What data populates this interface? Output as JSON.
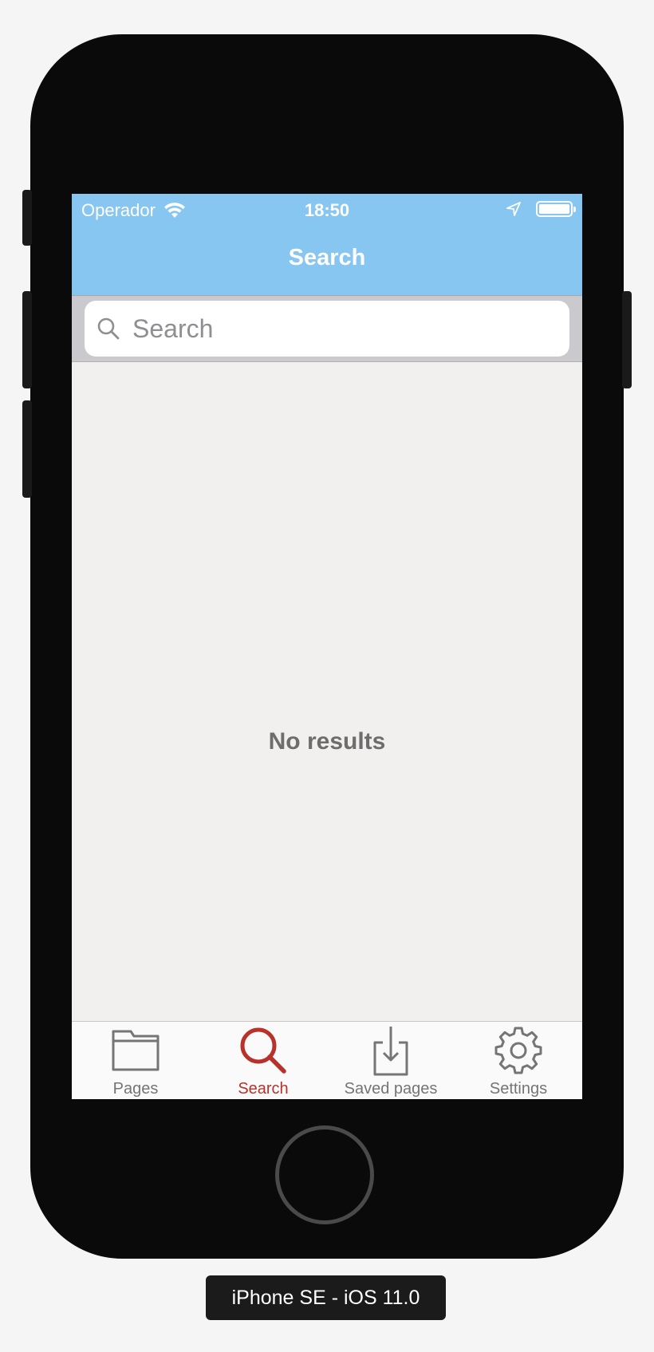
{
  "status_bar": {
    "carrier": "Operador",
    "time": "18:50"
  },
  "navbar": {
    "title": "Search"
  },
  "search": {
    "placeholder": "Search",
    "value": ""
  },
  "content": {
    "empty_message": "No results"
  },
  "tabbar": {
    "active_color": "#b8322b",
    "inactive_color": "#757575",
    "items": [
      {
        "label": "Pages",
        "icon": "folder-icon"
      },
      {
        "label": "Search",
        "icon": "search-icon",
        "active": true
      },
      {
        "label": "Saved pages",
        "icon": "download-icon"
      },
      {
        "label": "Settings",
        "icon": "gear-icon"
      }
    ]
  },
  "device": {
    "label": "iPhone SE - iOS 11.0"
  },
  "colors": {
    "navbar": "#86c6f0",
    "background": "#f1f0ee"
  }
}
